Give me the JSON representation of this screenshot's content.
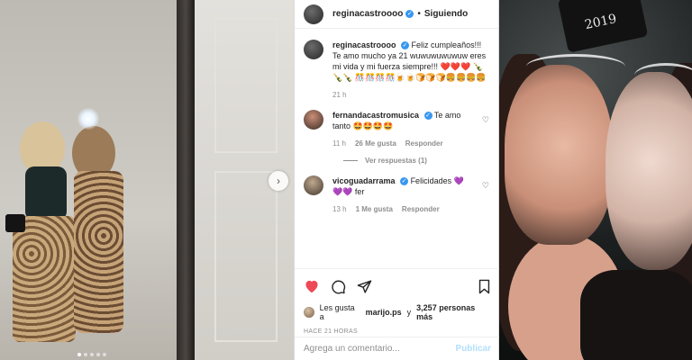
{
  "post": {
    "author": "reginacastroooo",
    "separator": "•",
    "following_label": "Siguiendo",
    "more_icon": "more-horizontal-icon"
  },
  "caption": {
    "user": "reginacastroooo",
    "text": "Feliz cumpleaños!!! Te amo mucho ya 21 wuwuwuwuwuw eres mi vida y mi fuerza siempre!!! ❤️❤️❤️ 🍾🍾🍾 🎊🎊🎊🎊🍺🍺🍞🍞🍞🍔🍔🍔🍔",
    "time": "21 h"
  },
  "comments": [
    {
      "user": "fernandacastromusica",
      "text": "Te amo tanto 🤩🤩🤩🤩",
      "time": "11 h",
      "likes": "26 Me gusta",
      "reply_label": "Responder"
    },
    {
      "user": "vicoguadarrama",
      "text": "Felicidades 💜💜💜 fer",
      "time": "13 h",
      "likes": "1 Me gusta",
      "reply_label": "Responder"
    }
  ],
  "view_replies": "Ver respuestas (1)",
  "likes": {
    "prefix": "Les gusta a",
    "user": "marijo.ps",
    "middle": "y",
    "count": "3,257 personas más"
  },
  "timestamp": "HACE 21 HORAS",
  "comment_input": {
    "placeholder": "Agrega un comentario...",
    "publish_label": "Publicar"
  },
  "colors": {
    "like_red": "#ed4956",
    "verified_blue": "#3897f0",
    "publish_disabled": "#b2dffc"
  }
}
